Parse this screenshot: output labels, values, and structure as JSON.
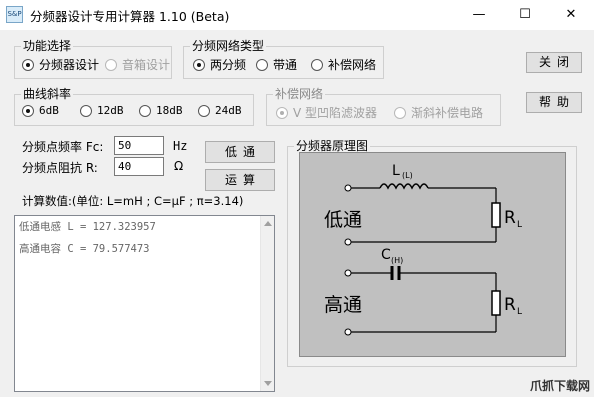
{
  "window": {
    "icon_text": "S&P",
    "title": "分频器设计专用计算器 1.10 (Beta)",
    "minimize_symbol": "—",
    "maximize_symbol": "☐",
    "close_symbol": "✕"
  },
  "function_group": {
    "title": "功能选择",
    "options": [
      {
        "label": "分频器设计",
        "checked": true,
        "enabled": true
      },
      {
        "label": "音箱设计",
        "checked": false,
        "enabled": false
      }
    ]
  },
  "network_type_group": {
    "title": "分频网络类型",
    "options": [
      {
        "label": "两分频",
        "checked": true
      },
      {
        "label": "带通",
        "checked": false
      },
      {
        "label": "补偿网络",
        "checked": false
      }
    ]
  },
  "slope_group": {
    "title": "曲线斜率",
    "options": [
      {
        "label": "6dB",
        "checked": true
      },
      {
        "label": "12dB",
        "checked": false
      },
      {
        "label": "18dB",
        "checked": false
      },
      {
        "label": "24dB",
        "checked": false
      }
    ]
  },
  "compensation_group": {
    "title": "补偿网络",
    "options": [
      {
        "label": "V 型凹陷滤波器",
        "checked": true
      },
      {
        "label": "渐斜补偿电路",
        "checked": false
      }
    ]
  },
  "buttons": {
    "close": "关闭",
    "help": "帮助",
    "low_pass": "低通",
    "calculate": "运算"
  },
  "inputs": {
    "frequency_label": "分频点频率 Fc:",
    "frequency_value": "50",
    "frequency_unit": "Hz",
    "impedance_label": "分频点阻抗 R:",
    "impedance_value": "40",
    "impedance_unit": "Ω"
  },
  "results": {
    "header": "计算数值:(单位: L=mH  ; C=μF ; π=3.14)",
    "lines": [
      "低通电感 L = 127.323957",
      "高通电容 C = 79.577473"
    ]
  },
  "diagram": {
    "title": "分频器原理图",
    "low_label": "低通",
    "high_label": "高通",
    "inductor_label": "L",
    "inductor_sub": "(L)",
    "capacitor_label": "C",
    "capacitor_sub": "(H)",
    "resistor_label": "R",
    "resistor_sub": "L"
  },
  "watermark": "爪抓下载网"
}
